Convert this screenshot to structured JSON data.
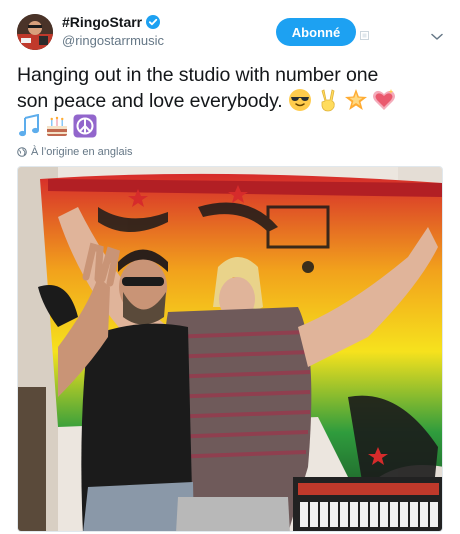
{
  "user": {
    "display_name": "#RingoStarr",
    "handle": "@ringostarrmusic",
    "verified": true
  },
  "follow_button": {
    "label": "Abonné"
  },
  "tweet": {
    "text_line1": "Hanging out in the studio with number one",
    "text_line2": "son peace and love everybody.",
    "emojis_line2": [
      "smiling-face-with-sunglasses",
      "victory-hand",
      "glowing-star",
      "sparkling-heart"
    ],
    "emojis_line3": [
      "musical-notes",
      "birthday-cake",
      "peace-symbol"
    ]
  },
  "translate": {
    "label": "À l’origine en anglais"
  },
  "photo": {
    "alt_icon": "photo"
  },
  "colors": {
    "accent": "#1da1f2",
    "text": "#14171a",
    "secondary": "#657786"
  }
}
